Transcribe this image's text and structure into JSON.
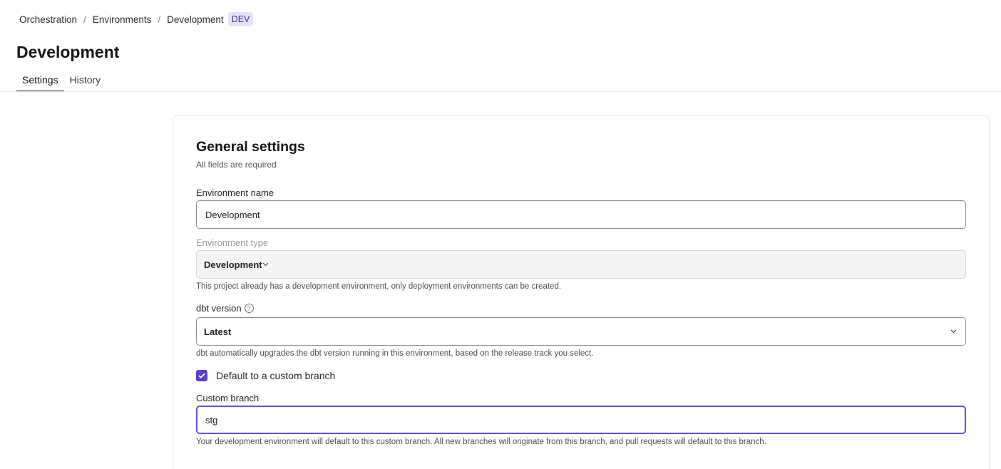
{
  "breadcrumb": {
    "items": [
      "Orchestration",
      "Environments",
      "Development"
    ],
    "separator": "/",
    "badge": "DEV"
  },
  "page": {
    "title": "Development"
  },
  "tabs": [
    {
      "label": "Settings",
      "active": true
    },
    {
      "label": "History",
      "active": false
    }
  ],
  "general": {
    "title": "General settings",
    "subtitle": "All fields are required"
  },
  "env_name": {
    "label": "Environment name",
    "value": "Development"
  },
  "env_type": {
    "label": "Environment type",
    "value": "Development",
    "help": "This project already has a development environment, only deployment environments can be created."
  },
  "dbt_version": {
    "label": "dbt version",
    "help_icon": "?",
    "value": "Latest",
    "help": "dbt automatically upgrades the dbt version running in this environment, based on the release track you select."
  },
  "custom_branch_toggle": {
    "label": "Default to a custom branch",
    "checked": true
  },
  "custom_branch": {
    "label": "Custom branch",
    "value": "stg",
    "help": "Your development environment will default to this custom branch. All new branches will originate from this branch, and pull requests will default to this branch."
  },
  "colors": {
    "accent": "#5b3fd1",
    "focus_border": "#6a4bd8",
    "badge_bg": "#e6e0fa"
  }
}
